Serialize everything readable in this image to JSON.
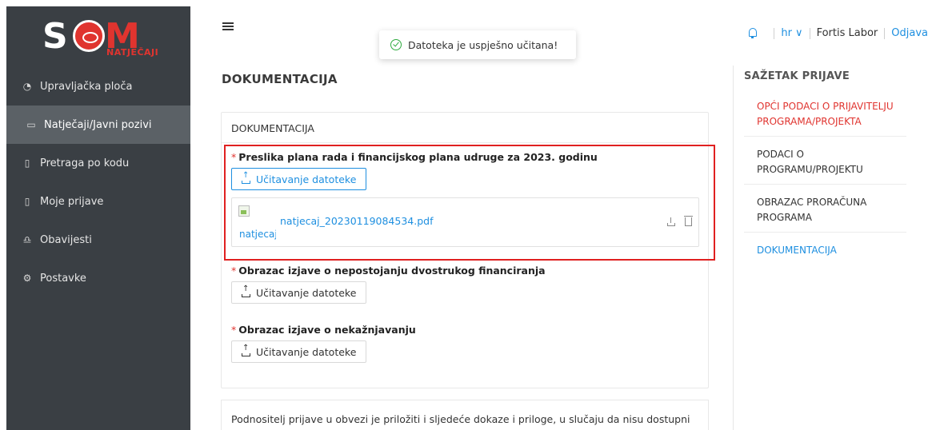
{
  "logo": {
    "text_left": "S",
    "text_right": "M",
    "subtitle": "NATJEČAJI"
  },
  "sidebar": {
    "items": [
      {
        "label": "Upravljačka ploča",
        "icon": "pie-chart-icon"
      },
      {
        "label": "Natječaji/Javni pozivi",
        "icon": "folder-open-icon",
        "active": true
      },
      {
        "label": "Pretraga po kodu",
        "icon": "document-icon"
      },
      {
        "label": "Moje prijave",
        "icon": "document-icon"
      },
      {
        "label": "Obavijesti",
        "icon": "bell-icon"
      },
      {
        "label": "Postavke",
        "icon": "gear-icon"
      }
    ]
  },
  "toast": {
    "message": "Datoteka je uspješno učitana!"
  },
  "header": {
    "lang": "hr ∨",
    "user": "Fortis Labor",
    "logout": "Odjava"
  },
  "main": {
    "title": "DOKUMENTACIJA",
    "card_title": "DOKUMENTACIJA",
    "fields": [
      {
        "label": "Preslika plana rada i financijskog plana udruge za 2023. godinu",
        "button": "Učitavanje datoteke",
        "file": {
          "name": "natjecaj_20230119084534.pdf",
          "alt": "natjecaj_20230119084534.pdf"
        }
      },
      {
        "label": "Obrazac izjave o nepostojanju dvostrukog financiranja",
        "button": "Učitavanje datoteke"
      },
      {
        "label": "Obrazac izjave o nekažnjavanju",
        "button": "Učitavanje datoteke"
      }
    ],
    "note": "Podnositelj prijave u obvezi je priložiti i sljedeće dokaze i priloge, u slučaju da nisu dostupni u odgovarajućoj elektroničkoj bazi podataka"
  },
  "summary": {
    "title": "SAŽETAK PRIJAVE",
    "items": [
      {
        "label": "OPĆI PODACI O PRIJAVITELJU PROGRAMA/PROJEKTA"
      },
      {
        "label": "PODACI O PROGRAMU/PROJEKTU"
      },
      {
        "label": "OBRAZAC PRORAČUNA PROGRAMA"
      },
      {
        "label": "DOKUMENTACIJA"
      }
    ]
  },
  "colors": {
    "accent": "#1e8fe0",
    "brand_red": "#e0342f",
    "sidebar_bg": "#3a3f44",
    "highlight": "#e02020"
  }
}
